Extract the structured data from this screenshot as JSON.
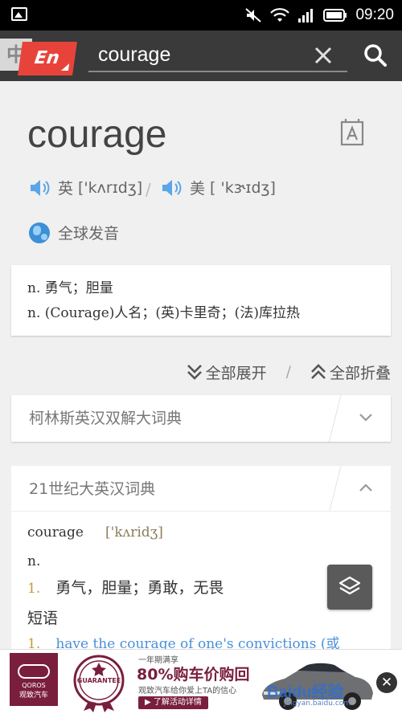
{
  "status_bar": {
    "time": "09:20"
  },
  "header": {
    "lang_zh": "中",
    "lang_en": "En",
    "query": "courage",
    "clear_icon": "close-icon",
    "search_icon": "search-icon"
  },
  "entry": {
    "word": "courage",
    "uk_label": "英",
    "uk_phonetic": "['kʌrɪdʒ]",
    "us_label": "美",
    "us_phonetic": "[ 'kɝɪdʒ]",
    "separator": "/",
    "global_pron": "全球发音"
  },
  "basic": {
    "lines": [
      "n. 勇气；胆量",
      "n. (Courage)人名；(英)卡里奇；(法)库拉热"
    ]
  },
  "controls": {
    "expand_all": "全部展开",
    "separator": "/",
    "collapse_all": "全部折叠"
  },
  "sections": {
    "collins_title": "柯林斯英汉双解大词典",
    "c21_title": "21世纪大英汉词典",
    "c21_word": "courage",
    "c21_phonetic": "['kʌridʒ]",
    "c21_pos": "n.",
    "c21_def_num": "1.",
    "c21_def": "勇气，胆量；勇敢，无畏",
    "c21_phrase_label": "短语",
    "c21_phrase_num": "1.",
    "c21_phrase": "have the courage of one's convictions (或"
  },
  "ad": {
    "brand": "QOROS",
    "brand_cn": "观致汽车",
    "badge": "GUARANTEE",
    "small": "一年期满享",
    "headline": "80%购车价购回",
    "sub": "观致汽车给你爱上TA的信心",
    "cta": "▶ 了解活动详情",
    "watermark": "Baidu经验",
    "watermark_url": "jingyan.baidu.com",
    "close": "✕"
  }
}
